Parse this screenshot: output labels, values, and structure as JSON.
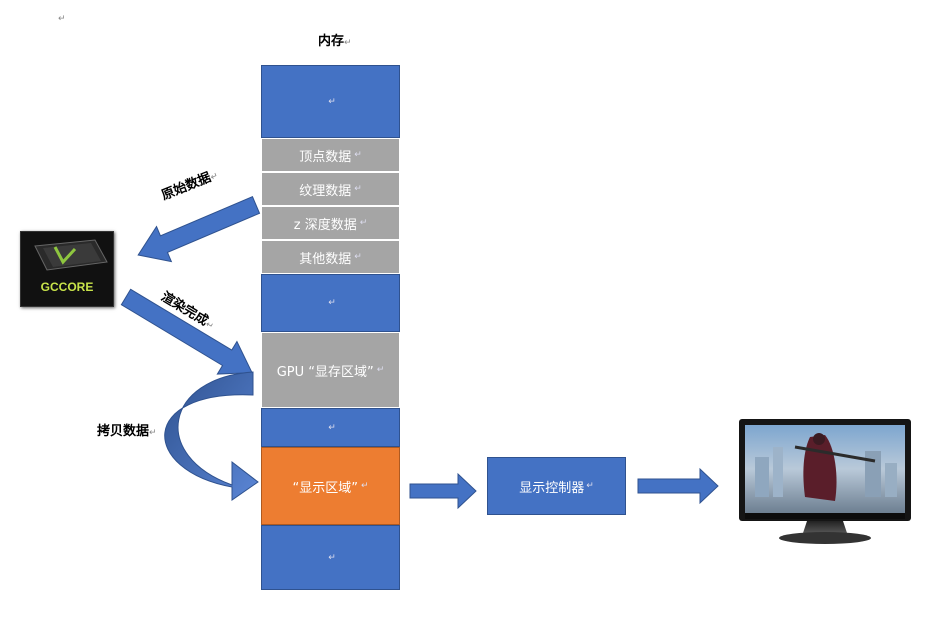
{
  "return_mark": "↵",
  "memory_title": "内存",
  "memory_blocks": {
    "vertex": "顶点数据",
    "texture": "纹理数据",
    "zdepth": "z 深度数据",
    "other": "其他数据",
    "gpu_region": "GPU “显存区域”",
    "display_region": "“显示区域”"
  },
  "labels": {
    "raw_data": "原始数据",
    "render_done": "渲染完成",
    "copy_data": "拷贝数据"
  },
  "gpu_chip": {
    "brand": "GCCORE"
  },
  "display_controller": "显示控制器",
  "colors": {
    "blue": "#4472c4",
    "gray": "#a5a5a5",
    "orange": "#ed7d31"
  }
}
